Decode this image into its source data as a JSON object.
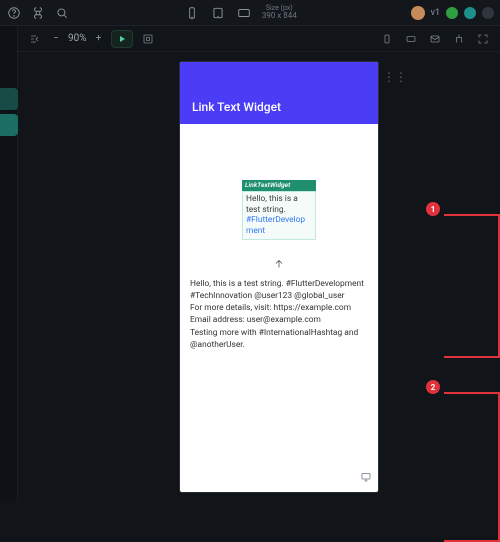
{
  "topbar": {
    "size_label_top": "Size (px)",
    "size_label_val": "390 x 844",
    "version": "v1"
  },
  "toolbar": {
    "zoom": "90%"
  },
  "phone": {
    "appbar_title": "Link Text Widget",
    "widget_header": "LinkTextWidget",
    "widget_plain_a": "Hello, this is a test string.",
    "widget_link": "#FlutterDevelopment",
    "paragraph": "Hello, this is a test string. #FlutterDevelopment #TechInnovation @user123 @global_user\nFor more details, visit: https://example.com\nEmail address: user@example.com\nTesting more with #InternationalHashtag and @anotherUser."
  },
  "annotations": {
    "n1": "1",
    "n2": "2"
  }
}
